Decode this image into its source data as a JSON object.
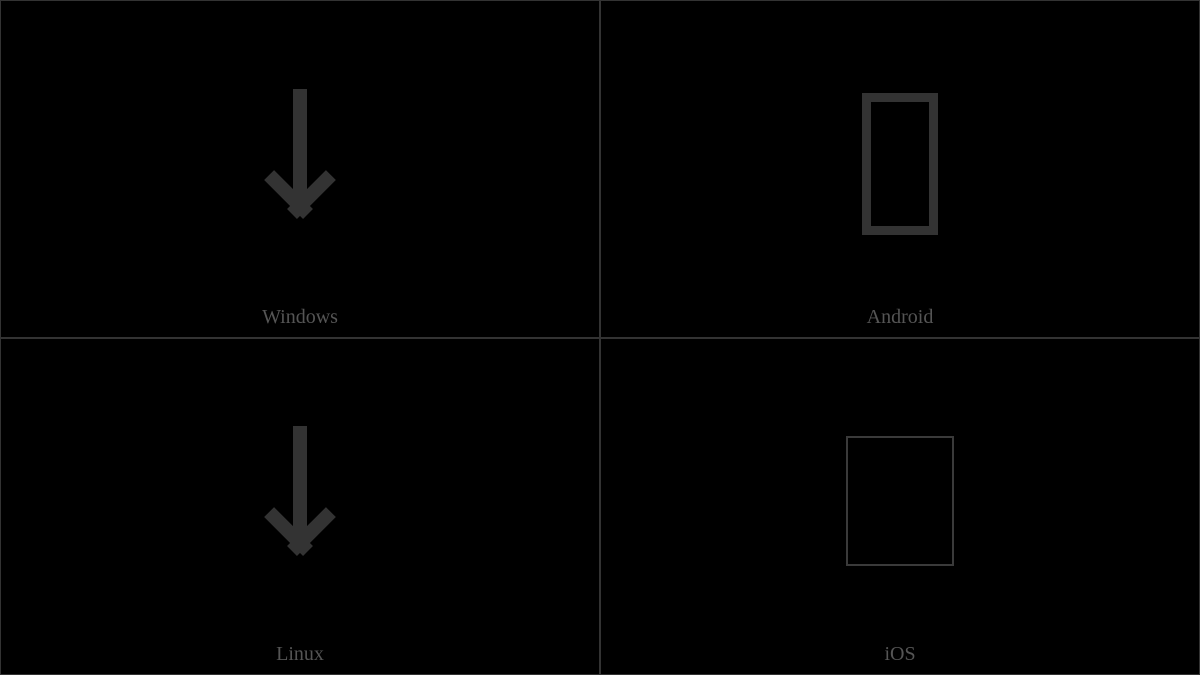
{
  "panels": [
    {
      "label": "Windows",
      "glyph": "arrow-down"
    },
    {
      "label": "Android",
      "glyph": "tofu-thick"
    },
    {
      "label": "Linux",
      "glyph": "arrow-down"
    },
    {
      "label": "iOS",
      "glyph": "tofu-thin"
    }
  ]
}
